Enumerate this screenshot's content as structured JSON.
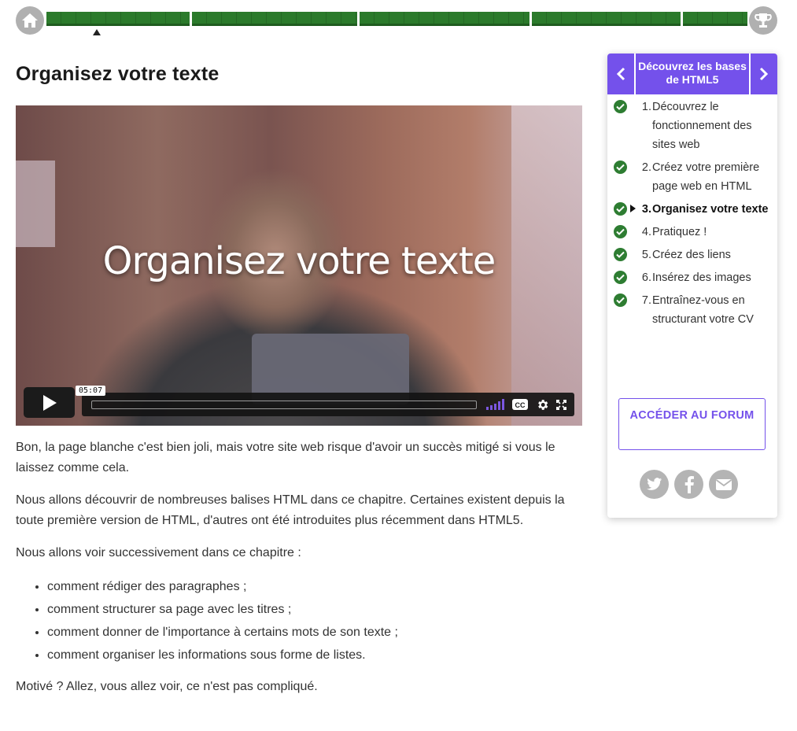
{
  "progress": {
    "home_icon": "home-icon",
    "trophy_icon": "trophy-icon",
    "segment_color": "#2b7a2b"
  },
  "page": {
    "title": "Organisez votre texte"
  },
  "video": {
    "overlay_title": "Organisez votre texte",
    "time": "05:07",
    "accent": "#7b57e0"
  },
  "article": {
    "paragraphs": [
      "Bon, la page blanche c'est bien joli, mais votre site web risque d'avoir un succès mitigé si vous le laissez comme cela.",
      "Nous allons découvrir de nombreuses balises HTML dans ce chapitre. Certaines existent depuis la toute première version de HTML, d'autres ont été introduites plus récemment dans HTML5.",
      "Nous allons voir successivement dans ce chapitre :"
    ],
    "list": [
      "comment rédiger des paragraphes ;",
      "comment structurer sa page avec les titres ;",
      "comment donner de l'importance à certains mots de son texte ;",
      "comment organiser les informations sous forme de listes."
    ],
    "closing": "Motivé ? Allez, vous allez voir, ce n'est pas compliqué."
  },
  "sidebar": {
    "title": "Découvrez les bases de HTML5",
    "accent": "#7451eb",
    "items": [
      {
        "num": "1.",
        "label": "Découvrez le fonctionnement des sites web"
      },
      {
        "num": "2.",
        "label": "Créez votre première page web en HTML"
      },
      {
        "num": "3.",
        "label": "Organisez votre texte"
      },
      {
        "num": "4.",
        "label": "Pratiquez !"
      },
      {
        "num": "5.",
        "label": "Créez des liens"
      },
      {
        "num": "6.",
        "label": "Insérez des images"
      },
      {
        "num": "7.",
        "label": "Entraînez-vous en structurant votre CV"
      }
    ],
    "forum_button": "ACCÉDER AU FORUM",
    "share_icons": [
      "twitter-icon",
      "facebook-icon",
      "mail-icon"
    ]
  }
}
